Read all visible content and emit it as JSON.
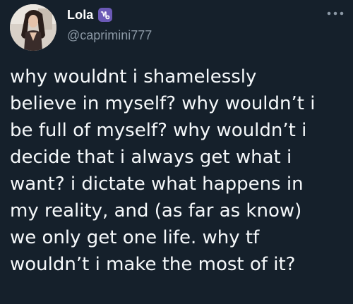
{
  "author": {
    "display_name": "Lola",
    "handle": "@caprimini777",
    "badge_icon": "capricorn-zodiac-icon",
    "badge_color": "#6b59b6"
  },
  "tweet": {
    "lines": [
      "why wouldnt i shamelessly",
      "believe in myself? why wouldn’t i",
      "be full of myself? why wouldn’t i",
      "decide that i always get what i",
      "want? i dictate what happens in",
      "my reality, and (as far as know)",
      "we only get one life. why tf",
      "wouldn’t i make the most of it?"
    ]
  },
  "actions": {
    "more_icon": "more-horizontal-icon"
  },
  "theme": {
    "background": "#15202b",
    "text": "#f5f8fa",
    "secondary_text": "#8b98a5"
  }
}
